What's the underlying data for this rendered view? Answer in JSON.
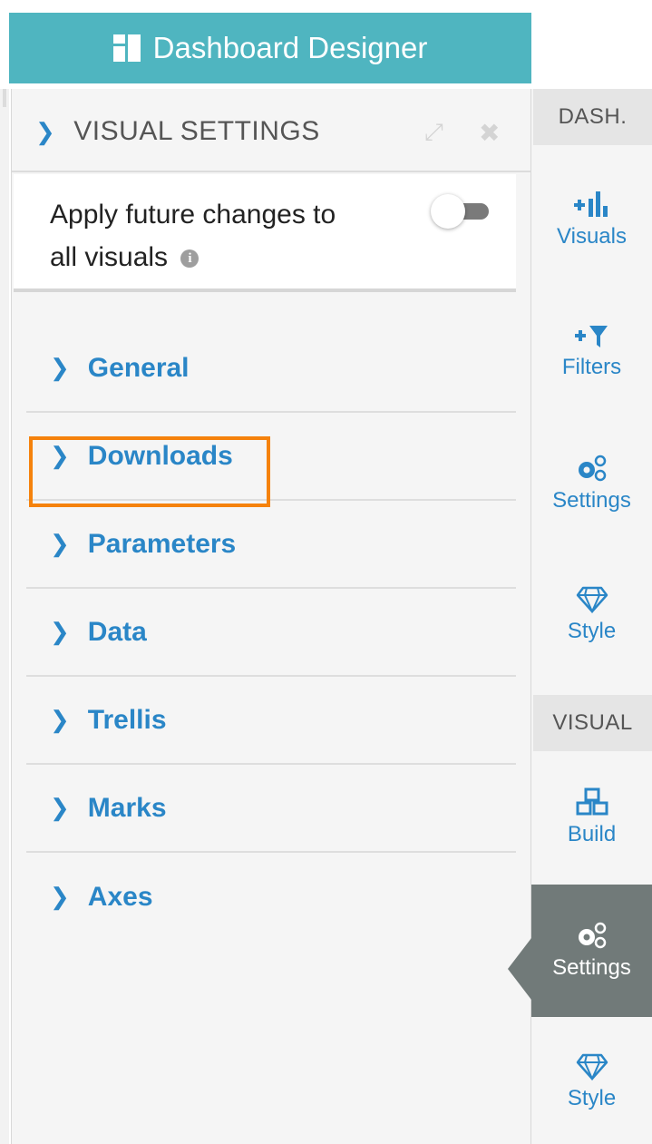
{
  "app": {
    "title": "Dashboard Designer",
    "icon": "dashboard-icon"
  },
  "panel": {
    "title": "VISUAL SETTINGS",
    "expand_icon": "expand-icon",
    "close_icon": "close-icon",
    "apply": {
      "line1": "Apply future changes to",
      "line2": "all visuals",
      "toggle_on": false,
      "info_icon": "info-icon"
    },
    "sections": [
      {
        "label": "General"
      },
      {
        "label": "Downloads",
        "highlighted": true
      },
      {
        "label": "Parameters"
      },
      {
        "label": "Data"
      },
      {
        "label": "Trellis"
      },
      {
        "label": "Marks"
      },
      {
        "label": "Axes"
      }
    ]
  },
  "rail": {
    "dash_header": "DASH.",
    "dash_items": [
      {
        "label": "Visuals",
        "icon": "add-chart-icon"
      },
      {
        "label": "Filters",
        "icon": "add-filter-icon"
      },
      {
        "label": "Settings",
        "icon": "gears-icon"
      },
      {
        "label": "Style",
        "icon": "diamond-icon"
      }
    ],
    "visual_header": "VISUAL",
    "visual_items": [
      {
        "label": "Build",
        "icon": "cubes-icon"
      },
      {
        "label": "Settings",
        "icon": "gears-icon",
        "active": true
      },
      {
        "label": "Style",
        "icon": "diamond-icon"
      }
    ]
  },
  "colors": {
    "title_bar": "#4fb5c0",
    "accent": "#2a86c7",
    "highlight": "#f5820c",
    "active_tab": "#717a79"
  }
}
